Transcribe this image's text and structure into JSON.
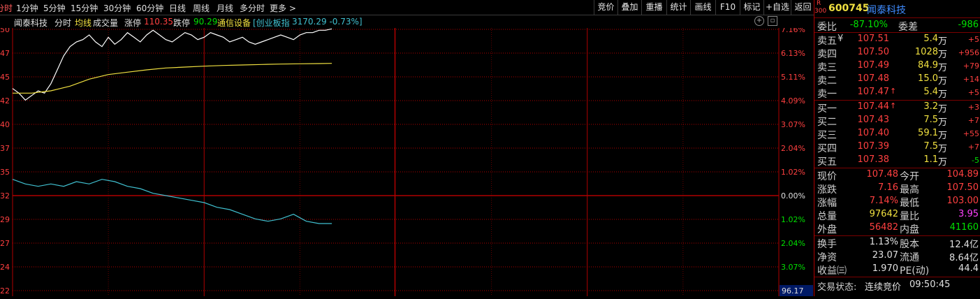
{
  "toolbar": {
    "tabs": [
      "分时",
      "1分钟",
      "5分钟",
      "15分钟",
      "30分钟",
      "60分钟",
      "日线",
      "周线",
      "月线",
      "多分时",
      "更多 >"
    ],
    "active_tab_index": 0,
    "right_buttons": [
      "竞价",
      "叠加",
      "重播",
      "统计",
      "画线",
      "F10",
      "标记",
      "+自选",
      "返回"
    ]
  },
  "info_bar": {
    "name": "闻泰科技",
    "mode": "分时",
    "avg_line_label": "均线",
    "volume_label": "成交量",
    "limit_up_label": "涨停",
    "limit_up_value": "110.35",
    "limit_down_label": "跌停",
    "limit_down_value": "90.29",
    "sector": "通信设备",
    "index_label": "[创业板指",
    "index_value": "3170.29 -0.73%]"
  },
  "chart_data": {
    "type": "line",
    "title": "",
    "price_axis": [
      "50",
      "47",
      "45",
      "42",
      "40",
      "37",
      "35",
      "32",
      "29",
      "27",
      "24",
      "22"
    ],
    "pct_axis": [
      "7.16%",
      "6.13%",
      "5.11%",
      "4.09%",
      "3.07%",
      "2.04%",
      "1.02%",
      "0.00%",
      "1.02%",
      "2.04%",
      "3.07%",
      ""
    ],
    "bottom_right_value": "96.17",
    "ylim": [
      -0.04,
      0.0716
    ],
    "x_minutes_total": 240,
    "series": [
      {
        "name": "price_pct",
        "color": "#ffffff",
        "x": [
          0,
          1,
          2,
          3,
          4,
          5,
          6,
          7,
          8,
          9,
          10,
          11,
          12,
          13,
          14,
          15,
          16,
          17,
          18,
          19,
          20,
          21,
          22,
          23,
          24,
          25,
          26,
          27,
          28,
          29,
          30,
          31,
          32,
          33,
          34,
          35,
          36,
          37,
          38,
          39,
          40,
          41,
          42,
          43,
          44,
          45,
          46,
          47,
          48,
          49,
          50
        ],
        "y": [
          0.046,
          0.044,
          0.041,
          0.043,
          0.045,
          0.044,
          0.048,
          0.054,
          0.06,
          0.064,
          0.066,
          0.067,
          0.069,
          0.066,
          0.064,
          0.068,
          0.065,
          0.067,
          0.07,
          0.068,
          0.066,
          0.069,
          0.071,
          0.069,
          0.067,
          0.066,
          0.068,
          0.07,
          0.069,
          0.067,
          0.068,
          0.07,
          0.069,
          0.068,
          0.066,
          0.067,
          0.068,
          0.066,
          0.065,
          0.066,
          0.067,
          0.068,
          0.069,
          0.068,
          0.067,
          0.069,
          0.07,
          0.07,
          0.071,
          0.071,
          0.0716
        ]
      },
      {
        "name": "avg_pct",
        "color": "#f0e040",
        "x": [
          0,
          3,
          6,
          9,
          12,
          15,
          18,
          21,
          24,
          27,
          30,
          33,
          36,
          39,
          42,
          45,
          48,
          50
        ],
        "y": [
          0.044,
          0.044,
          0.045,
          0.047,
          0.05,
          0.052,
          0.053,
          0.054,
          0.0548,
          0.0552,
          0.0556,
          0.0559,
          0.0561,
          0.0563,
          0.0565,
          0.0566,
          0.0567,
          0.0568
        ]
      },
      {
        "name": "ratio",
        "color": "#40c0d0",
        "x": [
          0,
          2,
          4,
          6,
          8,
          10,
          12,
          14,
          16,
          18,
          20,
          22,
          24,
          26,
          28,
          30,
          32,
          34,
          36,
          38,
          40,
          42,
          44,
          46,
          48,
          50
        ],
        "y": [
          0.007,
          0.005,
          0.004,
          0.005,
          0.004,
          0.006,
          0.005,
          0.007,
          0.006,
          0.004,
          0.003,
          0.001,
          0.0,
          -0.001,
          -0.002,
          -0.003,
          -0.005,
          -0.006,
          -0.008,
          -0.01,
          -0.011,
          -0.01,
          -0.008,
          -0.011,
          -0.012,
          -0.012
        ]
      }
    ]
  },
  "panel": {
    "code_badge_top": "R",
    "code_badge_bottom": "300",
    "code": "600745",
    "name": "闻泰科技",
    "weibi_label": "委比",
    "weibi_value": "-87.10%",
    "weicha_label": "委差",
    "weicha_value": "-986",
    "asks": [
      {
        "label": "卖五",
        "price": "107.51",
        "vol": "5.4",
        "unit": "万",
        "chg": "+5",
        "mark": "¥"
      },
      {
        "label": "卖四",
        "price": "107.50",
        "vol": "1028",
        "unit": "万",
        "chg": "+956",
        "mark": ""
      },
      {
        "label": "卖三",
        "price": "107.49",
        "vol": "84.9",
        "unit": "万",
        "chg": "+79",
        "mark": ""
      },
      {
        "label": "卖二",
        "price": "107.48",
        "vol": "15.0",
        "unit": "万",
        "chg": "+14",
        "mark": ""
      },
      {
        "label": "卖一",
        "price": "107.47",
        "vol": "5.4",
        "unit": "万",
        "chg": "+5",
        "mark": "↑"
      }
    ],
    "bids": [
      {
        "label": "买一",
        "price": "107.44",
        "vol": "3.2",
        "unit": "万",
        "chg": "+3",
        "mark": "↑"
      },
      {
        "label": "买二",
        "price": "107.43",
        "vol": "7.5",
        "unit": "万",
        "chg": "+7",
        "mark": ""
      },
      {
        "label": "买三",
        "price": "107.40",
        "vol": "59.1",
        "unit": "万",
        "chg": "+55",
        "mark": ""
      },
      {
        "label": "买四",
        "price": "107.39",
        "vol": "7.5",
        "unit": "万",
        "chg": "+7",
        "mark": ""
      },
      {
        "label": "买五",
        "price": "107.38",
        "vol": "1.1",
        "unit": "万",
        "chg": "-5",
        "mark": ""
      }
    ],
    "stats": [
      {
        "l1": "现价",
        "v1": "107.48",
        "c1": "red",
        "l2": "今开",
        "v2": "104.89",
        "c2": "red"
      },
      {
        "l1": "涨跌",
        "v1": "7.16",
        "c1": "red",
        "l2": "最高",
        "v2": "107.50",
        "c2": "red"
      },
      {
        "l1": "涨幅",
        "v1": "7.14%",
        "c1": "red",
        "l2": "最低",
        "v2": "103.00",
        "c2": "red"
      },
      {
        "l1": "总量",
        "v1": "97642",
        "c1": "yellow",
        "l2": "量比",
        "v2": "3.95",
        "c2": "magenta"
      },
      {
        "l1": "外盘",
        "v1": "56482",
        "c1": "red",
        "l2": "内盘",
        "v2": "41160",
        "c2": "green"
      }
    ],
    "stats2": [
      {
        "l1": "换手",
        "v1": "1.13%",
        "l2": "股本",
        "v2": "12.4亿"
      },
      {
        "l1": "净资",
        "v1": "23.07",
        "l2": "流通",
        "v2": "8.64亿"
      },
      {
        "l1": "收益㈢",
        "v1": "1.970",
        "l2": "PE(动)",
        "v2": "44.4"
      }
    ],
    "trade_status_label": "交易状态:",
    "trade_status_value": "连续竞价",
    "trade_time": "09:50:45"
  }
}
